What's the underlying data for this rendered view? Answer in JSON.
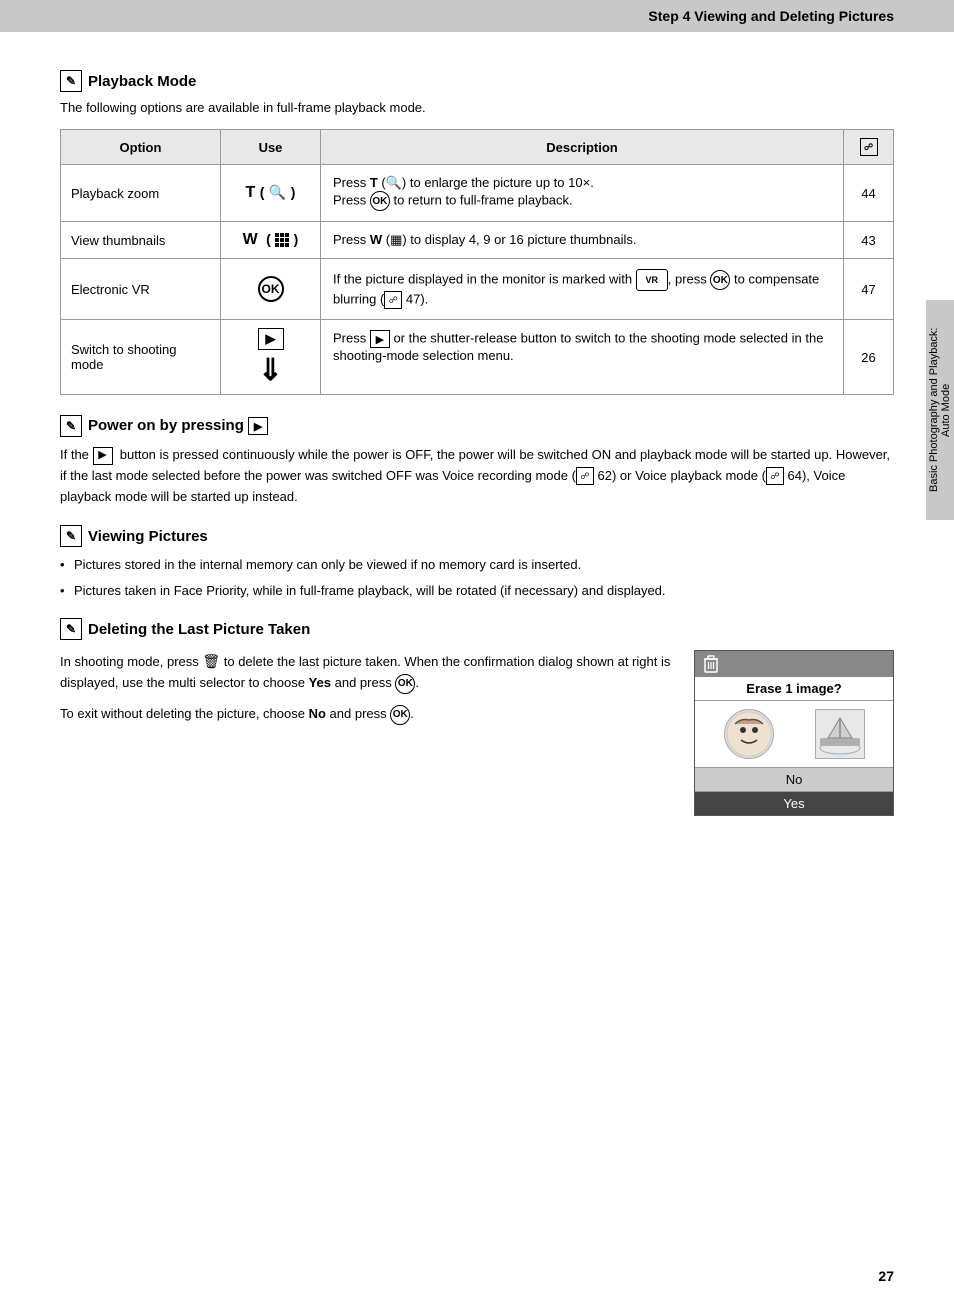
{
  "header": {
    "title": "Step 4 Viewing and Deleting Pictures"
  },
  "page_number": "27",
  "side_tab": "Basic Photography and Playback: Auto Mode",
  "playback_mode_section": {
    "title": "Playback Mode",
    "intro": "The following options are available in full-frame playback mode.",
    "table": {
      "headers": [
        "Option",
        "Use",
        "Description",
        ""
      ],
      "rows": [
        {
          "option": "Playback zoom",
          "use": "T(Q)",
          "description": "Press T (Q) to enlarge the picture up to 10×.\nPress OK to return to full-frame playback.",
          "page": "44"
        },
        {
          "option": "View thumbnails",
          "use": "W(grid)",
          "description": "Press W (grid) to display 4, 9 or 16 picture thumbnails.",
          "page": "43"
        },
        {
          "option": "Electronic VR",
          "use": "OK",
          "description": "If the picture displayed in the monitor is marked with VR, press OK to compensate blurring (ref 47).",
          "page": "47"
        },
        {
          "option": "Switch to shooting mode",
          "use": "play+arrow",
          "description": "Press play or the shutter-release button to switch to the shooting mode selected in the shooting-mode selection menu.",
          "page": "26"
        }
      ]
    }
  },
  "power_section": {
    "title": "Power on by pressing play",
    "body": "If the play button is pressed continuously while the power is OFF, the power will be switched ON and playback mode will be started up. However, if the last mode selected before the power was switched OFF was Voice recording mode (ref 62) or Voice playback mode (ref 64), Voice playback mode will be started up instead."
  },
  "viewing_section": {
    "title": "Viewing Pictures",
    "bullets": [
      "Pictures stored in the internal memory can only be viewed if no memory card is inserted.",
      "Pictures taken in Face Priority, while in full-frame playback, will be rotated (if necessary) and displayed."
    ]
  },
  "deleting_section": {
    "title": "Deleting the Last Picture Taken",
    "body1": "In shooting mode, press trash to delete the last picture taken. When the confirmation dialog shown at right is displayed, use the multi selector to choose Yes and press OK.",
    "body2": "To exit without deleting the picture, choose No and press OK.",
    "dialog": {
      "header": "trash icon",
      "title": "Erase 1 image?",
      "no_label": "No",
      "yes_label": "Yes"
    }
  }
}
